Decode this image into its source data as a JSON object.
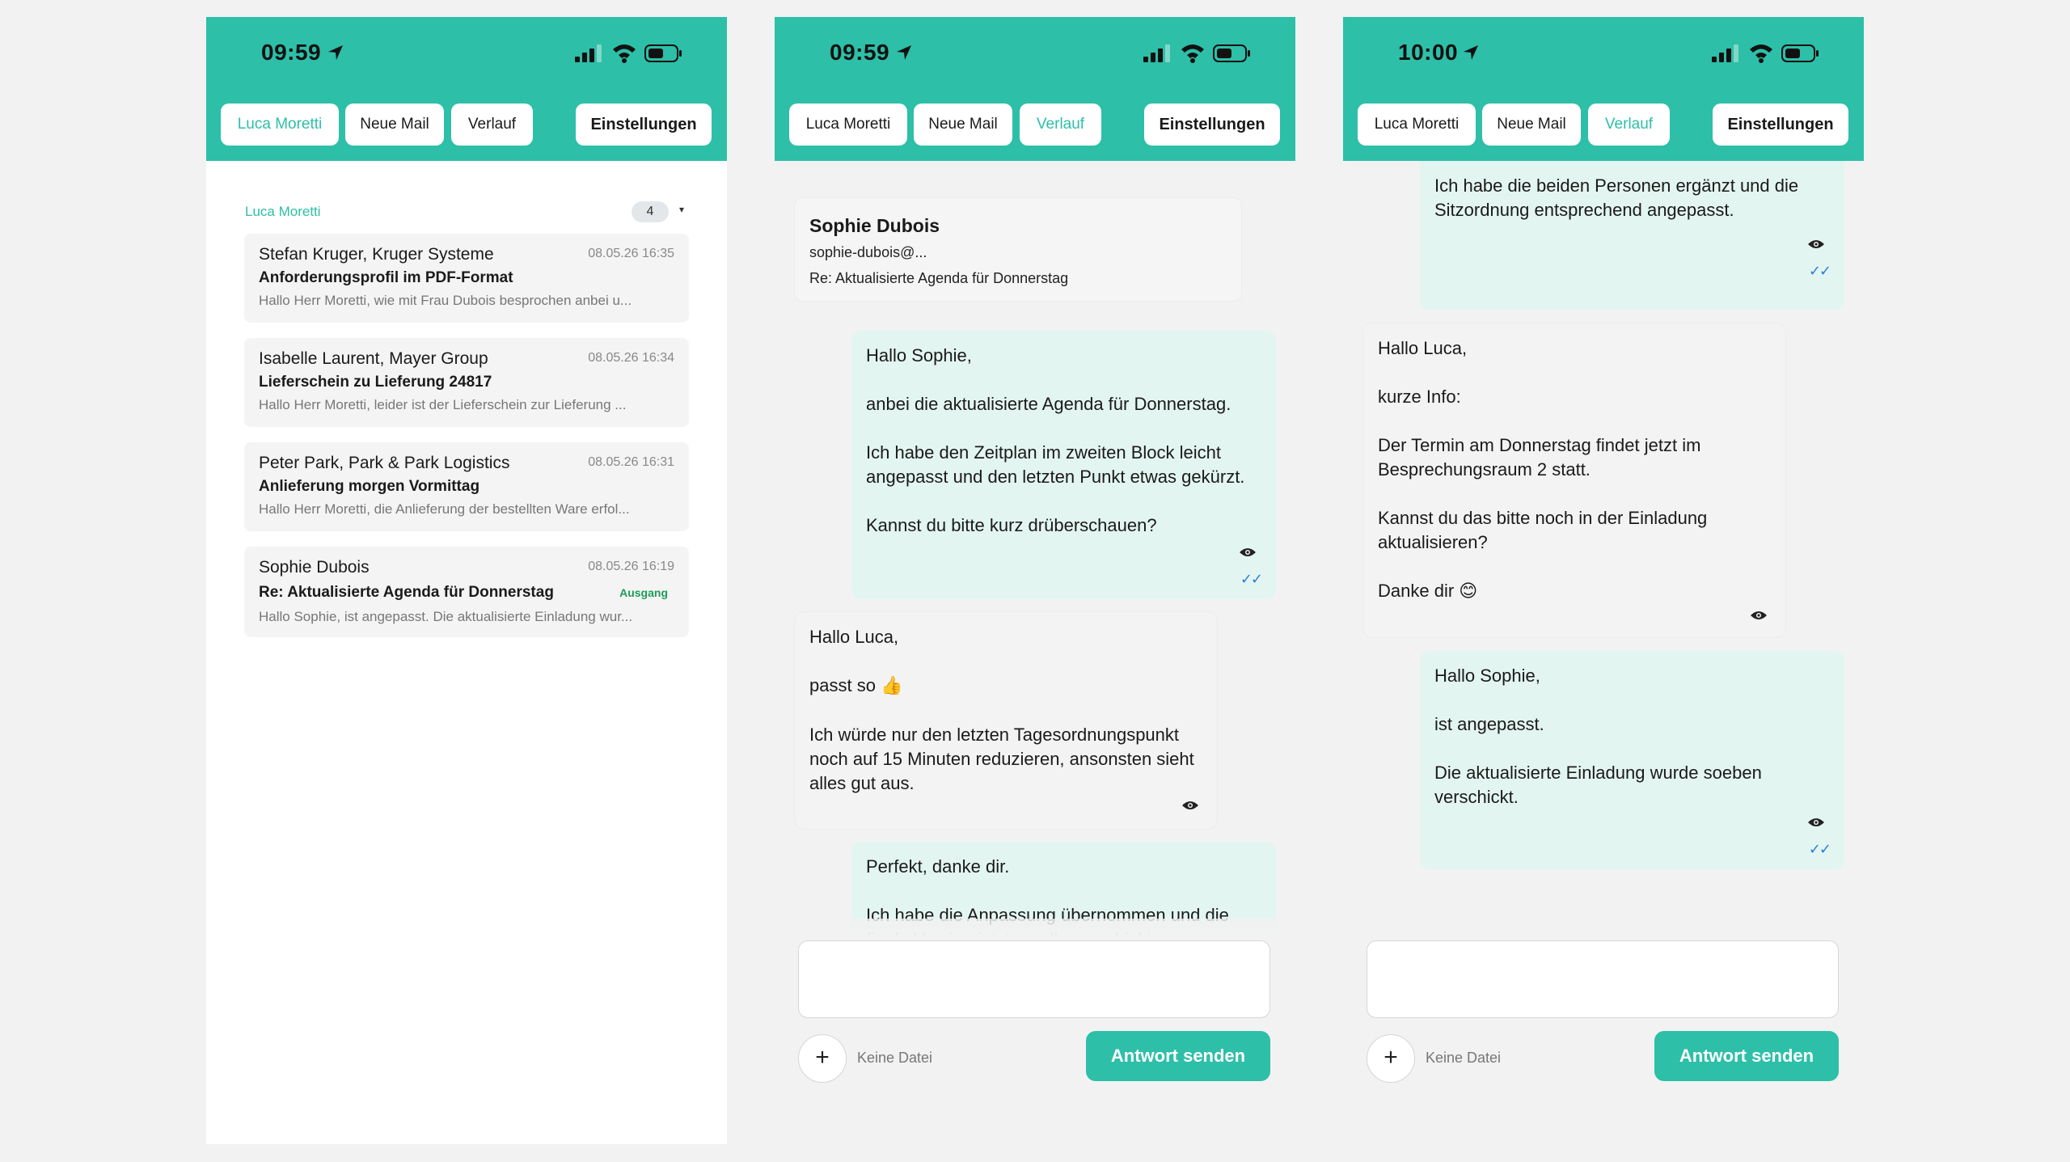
{
  "screens": [
    {
      "status": {
        "time": "09:59"
      },
      "tabs": {
        "contact": "Luca Moretti",
        "new_mail": "Neue Mail",
        "history": "Verlauf",
        "settings": "Einstellungen",
        "active": "contact"
      },
      "group": {
        "name": "Luca Moretti",
        "count": "4",
        "caret": "▾"
      },
      "mails": [
        {
          "sender": "Stefan Kruger, Kruger Systeme",
          "date": "08.05.26 16:35",
          "subject": "Anforderungsprofil im PDF-Format",
          "preview": "Hallo Herr Moretti, wie mit Frau Dubois besprochen anbei u...",
          "badge": ""
        },
        {
          "sender": "Isabelle Laurent, Mayer Group",
          "date": "08.05.26 16:34",
          "subject": "Lieferschein zu Lieferung 24817",
          "preview": "Hallo Herr Moretti, leider ist der Lieferschein zur Lieferung ...",
          "badge": ""
        },
        {
          "sender": "Peter Park, Park & Park Logistics",
          "date": "08.05.26 16:31",
          "subject": "Anlieferung morgen Vormittag",
          "preview": "Hallo Herr Moretti, die Anlieferung der bestellten Ware erfol...",
          "badge": ""
        },
        {
          "sender": "Sophie Dubois",
          "date": "08.05.26 16:19",
          "subject": "Re: Aktualisierte Agenda für Donnerstag",
          "preview": "Hallo Sophie, ist angepasst. Die aktualisierte Einladung wur...",
          "badge": "Ausgang"
        }
      ]
    },
    {
      "status": {
        "time": "09:59"
      },
      "tabs": {
        "contact": "Luca Moretti",
        "new_mail": "Neue Mail",
        "history": "Verlauf",
        "settings": "Einstellungen",
        "active": "history"
      },
      "contact_card": {
        "name": "Sophie Dubois",
        "email": "sophie-dubois@...",
        "subject": "Re: Aktualisierte Agenda für Donnerstag"
      },
      "messages": [
        {
          "direction": "out",
          "text": "Hallo Sophie,\n\nanbei die aktualisierte Agenda für Donnerstag.\n\nIch habe den Zeitplan im zweiten Block leicht angepasst und den letzten Punkt etwas gekürzt.\n\nKannst du bitte kurz drüberschauen?",
          "ticks": "✓✓"
        },
        {
          "direction": "in",
          "text_before_emoji": "Hallo Luca,\n\npasst so ",
          "emoji": "👍",
          "text_after_emoji": "\n\nIch würde nur den letzten Tagesordnungspunkt noch auf 15 Minuten reduzieren, ansonsten sieht alles gut aus."
        },
        {
          "direction": "out",
          "text": "Perfekt, danke dir.\n\nIch habe die Anpassung übernommen und die finale Version jetzt an alle verschickt."
        }
      ],
      "composer": {
        "attach": "+",
        "no_file": "Keine Datei",
        "send": "Antwort senden"
      }
    },
    {
      "status": {
        "time": "10:00"
      },
      "tabs": {
        "contact": "Luca Moretti",
        "new_mail": "Neue Mail",
        "history": "Verlauf",
        "settings": "Einstellungen",
        "active": "history"
      },
      "messages": [
        {
          "direction": "out",
          "text": "Ich habe die beiden Personen ergänzt und die Sitzordnung entsprechend angepasst.",
          "ticks": "✓✓"
        },
        {
          "direction": "in",
          "text_before_emoji": "Hallo Luca,\n\nkurze Info:\n\nDer Termin am Donnerstag findet jetzt im Besprechungsraum 2 statt.\n\nKannst du das bitte noch in der Einladung aktualisieren?\n\nDanke dir ",
          "emoji": "😊"
        },
        {
          "direction": "out",
          "text": "Hallo Sophie,\n\nist angepasst.\n\nDie aktualisierte Einladung wurde soeben verschickt.",
          "ticks": "✓✓"
        }
      ],
      "composer": {
        "attach": "+",
        "no_file": "Keine Datei",
        "send": "Antwort senden"
      }
    }
  ],
  "colors": {
    "accent": "#2dbfa8",
    "outgoing_bubble": "#e3f5f0",
    "incoming_bubble": "#f3f3f3",
    "read_ticks": "#2a7fd4",
    "outbox_badge": "#1e9b5b"
  },
  "icons": [
    "location-arrow-icon",
    "cellular-signal-icon",
    "wifi-icon",
    "battery-icon",
    "eye-icon",
    "double-check-icon",
    "plus-icon",
    "chevron-down-icon"
  ]
}
